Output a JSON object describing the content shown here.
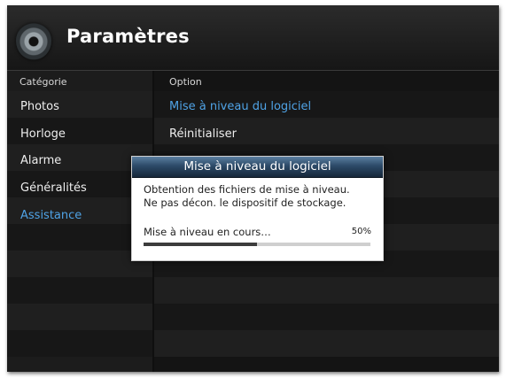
{
  "header": {
    "title": "Paramètres",
    "icon": "settings-gear-icon"
  },
  "category_column": {
    "header": "Catégorie",
    "items": [
      {
        "label": "Photos",
        "selected": false
      },
      {
        "label": "Horloge",
        "selected": false
      },
      {
        "label": "Alarme",
        "selected": false
      },
      {
        "label": "Généralités",
        "selected": false
      },
      {
        "label": "Assistance",
        "selected": true
      }
    ]
  },
  "option_column": {
    "header": "Option",
    "items": [
      {
        "label": "Mise à niveau du logiciel",
        "selected": true
      },
      {
        "label": "Réinitialiser",
        "selected": false
      }
    ]
  },
  "dialog": {
    "title": "Mise à niveau du logiciel",
    "message_lines": [
      "Obtention des fichiers de mise à niveau.",
      "Ne pas décon. le dispositif de stockage."
    ],
    "progress_label": "Mise à niveau en cours…",
    "progress_text": "50%",
    "progress_value": 0.5
  },
  "colors": {
    "selected_text": "#4fa3e6",
    "dialog_title_bar": "#2c4a68",
    "background": "#0f0f0f"
  }
}
